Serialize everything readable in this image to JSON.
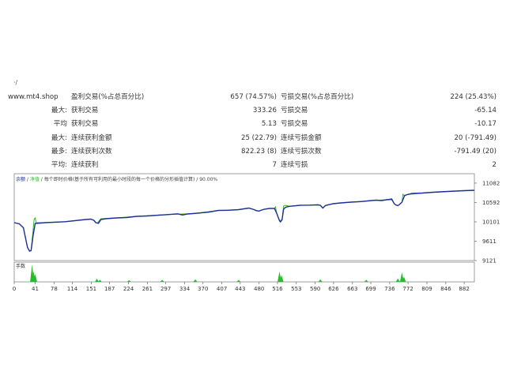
{
  "header_mark": "·/",
  "stats": {
    "site": "www.mt4.shop",
    "rows": [
      {
        "label": "",
        "name1": "盈利交易(%占总百分比)",
        "val1": "657 (74.57%)",
        "name2": "亏损交易(%占总百分比)",
        "val2": "224 (25.43%)"
      },
      {
        "label": "最大:",
        "name1": "获利交易",
        "val1": "333.26",
        "name2": "亏损交易",
        "val2": "-65.14"
      },
      {
        "label": "平均",
        "name1": "获利交易",
        "val1": "5.13",
        "name2": "亏损交易",
        "val2": "-10.17"
      },
      {
        "label": "最大:",
        "name1": "连续获利金额",
        "val1": "25 (22.79)",
        "name2": "连续亏损金额",
        "val2": "20 (-791.49)"
      },
      {
        "label": "最多:",
        "name1": "连续获利次数",
        "val1": "822.23 (8)",
        "name2": "连续亏损次数",
        "val2": "-791.49 (20)"
      },
      {
        "label": "平均:",
        "name1": "连续获利",
        "val1": "7",
        "name2": "连续亏损",
        "val2": "2"
      }
    ]
  },
  "chart_data": {
    "type": "line",
    "legend": {
      "balance": "余额",
      "equity": "净值",
      "note": "每个即时价格(基于所有可利用的最小时段的每一个价格的分形插值计算)",
      "quality": "90.00%"
    },
    "yticks": [
      9121,
      9611,
      10101,
      10592,
      11082
    ],
    "ylim": [
      9121,
      11320
    ],
    "xticks": [
      0,
      41,
      78,
      114,
      151,
      187,
      224,
      261,
      297,
      334,
      370,
      407,
      443,
      480,
      516,
      553,
      590,
      626,
      663,
      699,
      736,
      772,
      809,
      846,
      882
    ],
    "xlim": [
      0,
      902
    ],
    "volume_label": "手数",
    "series": [
      {
        "name": "余额",
        "color": "#1f2f9a",
        "x": [
          0,
          10,
          18,
          22,
          26,
          30,
          33,
          37,
          41,
          60,
          100,
          140,
          150,
          156,
          160,
          165,
          170,
          180,
          200,
          220,
          240,
          260,
          300,
          320,
          330,
          340,
          350,
          380,
          400,
          420,
          440,
          460,
          470,
          475,
          480,
          485,
          490,
          500,
          510,
          515,
          520,
          522,
          525,
          528,
          531,
          534,
          540,
          560,
          580,
          595,
          600,
          605,
          610,
          625,
          640,
          660,
          680,
          700,
          710,
          720,
          730,
          740,
          745,
          748,
          752,
          755,
          760,
          765,
          770,
          780,
          800,
          820,
          850,
          880,
          902
        ],
        "y": [
          10080,
          10050,
          9950,
          9700,
          9450,
          9360,
          9370,
          9760,
          10060,
          10080,
          10105,
          10160,
          10170,
          10140,
          10080,
          10065,
          10160,
          10180,
          10200,
          10210,
          10240,
          10250,
          10285,
          10305,
          10275,
          10300,
          10310,
          10345,
          10390,
          10395,
          10410,
          10450,
          10410,
          10380,
          10375,
          10400,
          10420,
          10440,
          10440,
          10300,
          10130,
          10100,
          10150,
          10420,
          10460,
          10480,
          10495,
          10520,
          10525,
          10535,
          10520,
          10450,
          10515,
          10560,
          10580,
          10600,
          10615,
          10640,
          10650,
          10640,
          10660,
          10670,
          10560,
          10530,
          10510,
          10540,
          10600,
          10760,
          10790,
          10820,
          10830,
          10850,
          10870,
          10890,
          10900
        ]
      },
      {
        "name": "净值",
        "color": "#2db82d",
        "x": [
          0,
          10,
          18,
          22,
          26,
          30,
          33,
          36,
          39,
          41,
          43,
          60,
          100,
          140,
          150,
          156,
          160,
          163,
          165,
          170,
          200,
          240,
          300,
          330,
          350,
          400,
          440,
          460,
          470,
          480,
          490,
          500,
          510,
          512,
          515,
          520,
          525,
          528,
          531,
          540,
          560,
          580,
          600,
          605,
          610,
          625,
          660,
          700,
          730,
          740,
          745,
          748,
          752,
          755,
          760,
          762,
          764,
          770,
          800,
          850,
          902
        ],
        "y": [
          10080,
          10050,
          9950,
          9700,
          9450,
          9360,
          9370,
          9760,
          10170,
          10200,
          10080,
          10080,
          10105,
          10160,
          10170,
          10140,
          10080,
          10065,
          10110,
          10180,
          10200,
          10240,
          10285,
          10300,
          10310,
          10390,
          10410,
          10450,
          10410,
          10375,
          10420,
          10440,
          10440,
          10480,
          10300,
          10130,
          10150,
          10500,
          10520,
          10495,
          10520,
          10525,
          10520,
          10450,
          10515,
          10560,
          10600,
          10640,
          10660,
          10690,
          10560,
          10530,
          10510,
          10540,
          10600,
          10800,
          10770,
          10790,
          10830,
          10870,
          10900
        ]
      }
    ],
    "volume_spikes": [
      {
        "x": 35,
        "v": 1.0
      },
      {
        "x": 38,
        "v": 0.6
      },
      {
        "x": 41,
        "v": 0.45
      },
      {
        "x": 162,
        "v": 0.18
      },
      {
        "x": 168,
        "v": 0.12
      },
      {
        "x": 225,
        "v": 0.1
      },
      {
        "x": 290,
        "v": 0.12
      },
      {
        "x": 355,
        "v": 0.15
      },
      {
        "x": 440,
        "v": 0.12
      },
      {
        "x": 520,
        "v": 0.6
      },
      {
        "x": 524,
        "v": 0.4
      },
      {
        "x": 600,
        "v": 0.15
      },
      {
        "x": 690,
        "v": 0.12
      },
      {
        "x": 752,
        "v": 0.2
      },
      {
        "x": 760,
        "v": 0.55
      },
      {
        "x": 764,
        "v": 0.3
      }
    ]
  }
}
